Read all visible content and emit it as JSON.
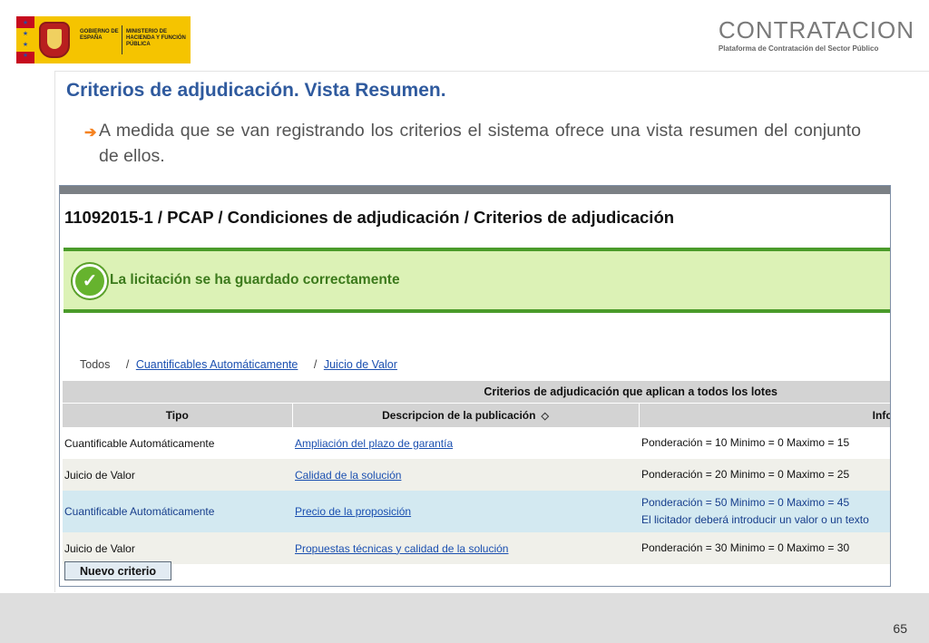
{
  "header": {
    "gov_logo": {
      "line1": "GOBIERNO DE ESPAÑA",
      "line2": "MINISTERIO DE HACIENDA Y FUNCIÓN PÚBLICA"
    },
    "brand": {
      "name": "CONTRATACION",
      "subtitle": "Plataforma de Contratación del Sector Público",
      "accent_color": "#2aa9e0"
    }
  },
  "slide": {
    "title": "Criterios de adjudicación. Vista Resumen.",
    "bullet": "A medida que se van registrando los criterios el sistema ofrece una vista resumen del conjunto de ellos.",
    "bullet_icon": "arrow-right-icon",
    "page_number": "65"
  },
  "app": {
    "breadcrumb": "11092015-1 / PCAP / Condiciones de adjudicación / Criterios de adjudicación",
    "success_message": "La licitación se ha guardado correctamente",
    "success_icon": "check-circle-icon",
    "tabs": {
      "all": "Todos",
      "sep": "/",
      "automatic": "Cuantificables Automáticamente",
      "judgement": "Juicio de Valor"
    },
    "table": {
      "group_header": "Criterios de adjudicación que aplican a todos los lotes",
      "columns": {
        "tipo": "Tipo",
        "descripcion": "Descripcion de la publicación",
        "info": "Inform"
      },
      "rows": [
        {
          "tipo": "Cuantificable Automáticamente",
          "descripcion": "Ampliación del plazo de garantía",
          "info": "Ponderación = 10 Minimo = 0 Maximo = 15",
          "info2": ""
        },
        {
          "tipo": "Juicio de Valor",
          "descripcion": "Calidad de la solución",
          "info": "Ponderación = 20 Minimo = 0 Maximo = 25",
          "info2": ""
        },
        {
          "tipo": "Cuantificable Automáticamente",
          "descripcion": "Precio de la proposición",
          "info": "Ponderación = 50 Minimo = 0 Maximo = 45",
          "info2": "El licitador deberá introducir un valor o un texto"
        },
        {
          "tipo": "Juicio de Valor",
          "descripcion": "Propuestas técnicas y calidad de la solución",
          "info": "Ponderación = 30 Minimo = 0 Maximo = 30",
          "info2": ""
        }
      ]
    },
    "new_button": "Nuevo criterio"
  }
}
